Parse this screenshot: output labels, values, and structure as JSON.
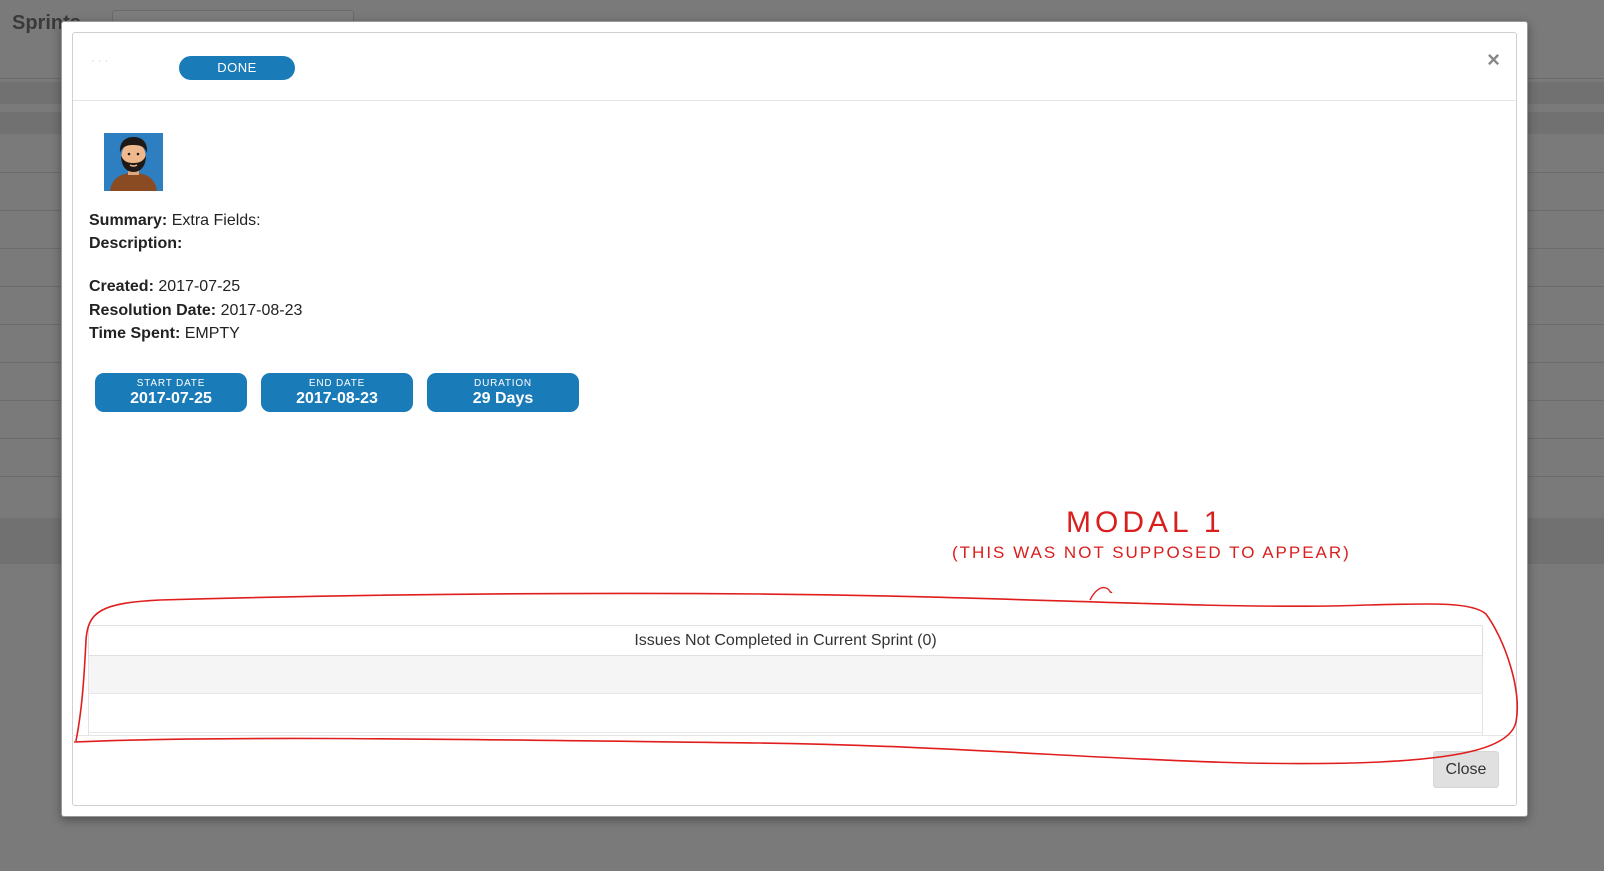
{
  "background": {
    "title": "Sprints"
  },
  "modal": {
    "header": {
      "status": "DONE",
      "close_icon": "×"
    },
    "avatar": "avatar-icon",
    "fields": {
      "summary_label": "Summary:",
      "summary_value": "Extra Fields:",
      "description_label": "Description:",
      "description_value": "",
      "created_label": "Created:",
      "created_value": "2017-07-25",
      "resolution_label": "Resolution Date:",
      "resolution_value": "2017-08-23",
      "time_spent_label": "Time Spent:",
      "time_spent_value": "EMPTY"
    },
    "stats": [
      {
        "label": "START DATE",
        "value": "2017-07-25"
      },
      {
        "label": "END DATE",
        "value": "2017-08-23"
      },
      {
        "label": "DURATION",
        "value": "29 Days"
      }
    ],
    "issues_panel": {
      "title": "Issues Not Completed in Current Sprint (0)"
    },
    "footer": {
      "close_label": "Close"
    }
  },
  "annotation": {
    "title": "MODAL 1",
    "subtitle": "(THIS WAS NOT SUPPOSED TO APPEAR)",
    "color": "#d91e1e"
  },
  "colors": {
    "accent": "#1a7bb9",
    "overlay": "#767676"
  }
}
